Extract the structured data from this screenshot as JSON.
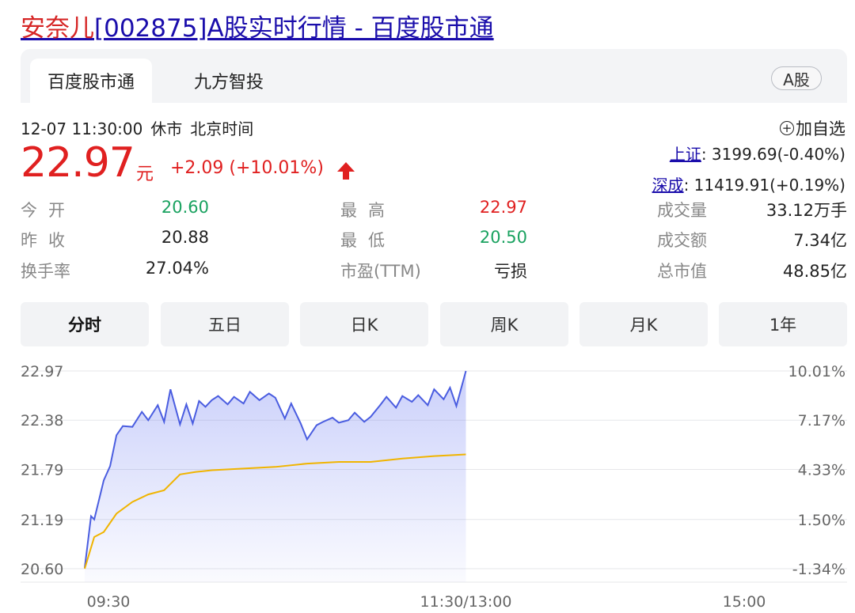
{
  "page_title": {
    "stock_name": "安奈儿",
    "rest": "[002875]A股实时行情 - 百度股市通"
  },
  "tabs": [
    {
      "label": "百度股市通"
    },
    {
      "label": "九方智投"
    }
  ],
  "market_badge": "A股",
  "status": {
    "datetime": "12-07 11:30:00",
    "state": "休市",
    "timezone": "北京时间"
  },
  "price": {
    "current": "22.97",
    "unit": "元",
    "change": "+2.09 (+10.01%)",
    "direction": "up"
  },
  "watch_button": {
    "icon": "plus-circle-icon",
    "label": "加自选"
  },
  "indices": [
    {
      "name": "上证",
      "value": ": 3199.69(-0.40%)"
    },
    {
      "name": "深成",
      "value": ": 11419.91(+0.19%)"
    }
  ],
  "stats": {
    "open": {
      "label": "今开",
      "value": "20.60"
    },
    "prev_close": {
      "label": "昨收",
      "value": "20.88"
    },
    "turnover_rate": {
      "label": "换手率",
      "value": "27.04%"
    },
    "high": {
      "label": "最高",
      "value": "22.97"
    },
    "low": {
      "label": "最低",
      "value": "20.50"
    },
    "pe_ttm": {
      "label": "市盈(TTM)",
      "value": "亏损"
    },
    "volume": {
      "label": "成交量",
      "value": "33.12万手"
    },
    "amount": {
      "label": "成交额",
      "value": "7.34亿"
    },
    "market_cap": {
      "label": "总市值",
      "value": "48.85亿"
    }
  },
  "periods": [
    {
      "label": "分时",
      "active": true
    },
    {
      "label": "五日"
    },
    {
      "label": "日K"
    },
    {
      "label": "周K"
    },
    {
      "label": "月K"
    },
    {
      "label": "1年"
    }
  ],
  "colors": {
    "up": "#e02020",
    "down": "#1aa260",
    "price_line": "#4a5de0",
    "avg_line": "#f0b400",
    "link": "#1a0dab"
  },
  "chart_data": {
    "type": "line",
    "y_left_ticks": [
      "22.97",
      "22.38",
      "21.79",
      "21.19",
      "20.60"
    ],
    "y_right_ticks": [
      "10.01%",
      "7.17%",
      "4.33%",
      "1.50%",
      "-1.34%"
    ],
    "x_ticks": [
      "09:30",
      "11:30/13:00",
      "15:00"
    ],
    "ylim": [
      20.6,
      22.97
    ],
    "series": [
      {
        "role": "price",
        "x": [
          "09:30",
          "09:32",
          "09:33",
          "09:36",
          "09:38",
          "09:40",
          "09:42",
          "09:45",
          "09:48",
          "09:50",
          "09:53",
          "09:55",
          "09:57",
          "10:00",
          "10:02",
          "10:04",
          "10:06",
          "10:08",
          "10:10",
          "10:12",
          "10:15",
          "10:17",
          "10:20",
          "10:22",
          "10:25",
          "10:28",
          "10:30",
          "10:33",
          "10:35",
          "10:38",
          "10:40",
          "10:43",
          "10:45",
          "10:48",
          "10:50",
          "10:53",
          "10:55",
          "10:58",
          "11:00",
          "11:03",
          "11:05",
          "11:08",
          "11:10",
          "11:13",
          "11:15",
          "11:18",
          "11:20",
          "11:23",
          "11:25",
          "11:27",
          "11:30"
        ],
        "values": [
          20.61,
          21.23,
          21.19,
          21.66,
          21.83,
          22.2,
          22.31,
          22.3,
          22.48,
          22.38,
          22.56,
          22.36,
          22.75,
          22.33,
          22.57,
          22.34,
          22.61,
          22.54,
          22.62,
          22.67,
          22.57,
          22.66,
          22.58,
          22.72,
          22.62,
          22.7,
          22.65,
          22.4,
          22.58,
          22.34,
          22.15,
          22.32,
          22.36,
          22.41,
          22.35,
          22.38,
          22.47,
          22.36,
          22.42,
          22.56,
          22.66,
          22.53,
          22.67,
          22.6,
          22.68,
          22.56,
          22.75,
          22.63,
          22.77,
          22.55,
          22.97
        ]
      },
      {
        "role": "average",
        "x": [
          "09:30",
          "09:33",
          "09:36",
          "09:40",
          "09:45",
          "09:50",
          "09:55",
          "10:00",
          "10:05",
          "10:10",
          "10:20",
          "10:30",
          "10:40",
          "10:50",
          "11:00",
          "11:10",
          "11:20",
          "11:30"
        ],
        "values": [
          20.6,
          20.98,
          21.04,
          21.26,
          21.4,
          21.49,
          21.54,
          21.73,
          21.76,
          21.78,
          21.8,
          21.82,
          21.86,
          21.88,
          21.88,
          21.92,
          21.95,
          21.97
        ]
      }
    ]
  }
}
